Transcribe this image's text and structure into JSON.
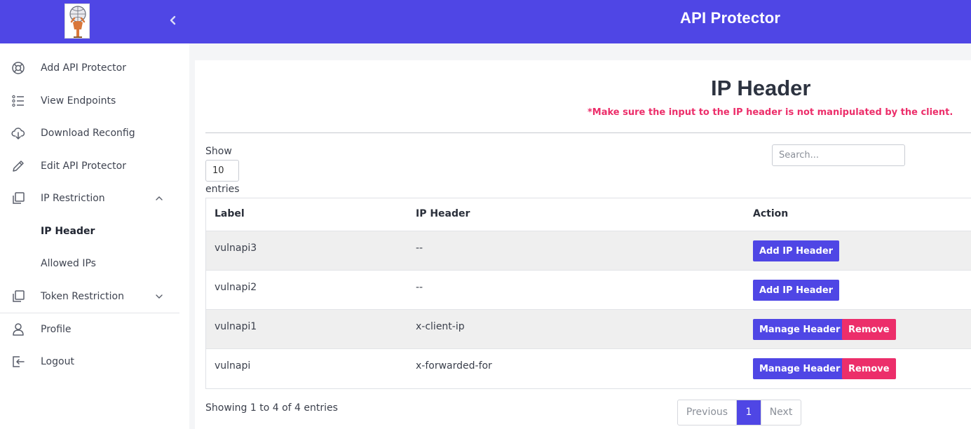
{
  "app": {
    "title": "API Protector"
  },
  "sidebar": {
    "items": [
      {
        "label": "Add API Protector",
        "icon": "lifebuoy-icon"
      },
      {
        "label": "View Endpoints",
        "icon": "list-icon"
      },
      {
        "label": "Download Reconfig",
        "icon": "cloud-download-icon"
      },
      {
        "label": "Edit API Protector",
        "icon": "pencil-icon"
      },
      {
        "label": "IP Restriction",
        "icon": "copy-icon",
        "expanded": true
      },
      {
        "label": "IP Header",
        "active": true
      },
      {
        "label": "Allowed IPs"
      },
      {
        "label": "Token Restriction",
        "icon": "copy-icon",
        "expanded": false
      },
      {
        "label": "Profile",
        "icon": "user-icon"
      },
      {
        "label": "Logout",
        "icon": "logout-icon"
      }
    ]
  },
  "page": {
    "title": "IP Header",
    "warning": "*Make sure the input to the IP header is not manipulated by the client."
  },
  "table_controls": {
    "show_label": "Show",
    "page_size": "10",
    "entries_label": "entries",
    "search_placeholder": "Search..."
  },
  "table": {
    "columns": [
      "Label",
      "IP Header",
      "Action"
    ],
    "rows": [
      {
        "label": "vulnapi3",
        "ip_header": "--",
        "actions": [
          "Add IP Header"
        ]
      },
      {
        "label": "vulnapi2",
        "ip_header": "--",
        "actions": [
          "Add IP Header"
        ]
      },
      {
        "label": "vulnapi1",
        "ip_header": "x-client-ip",
        "actions": [
          "Manage Header",
          "Remove"
        ]
      },
      {
        "label": "vulnapi",
        "ip_header": "x-forwarded-for",
        "actions": [
          "Manage Header",
          "Remove"
        ]
      }
    ]
  },
  "pagination": {
    "info": "Showing 1 to 4 of 4 entries",
    "previous": "Previous",
    "current_page": "1",
    "next": "Next"
  },
  "colors": {
    "brand": "#4f46e5",
    "danger": "#ec2e6a"
  }
}
